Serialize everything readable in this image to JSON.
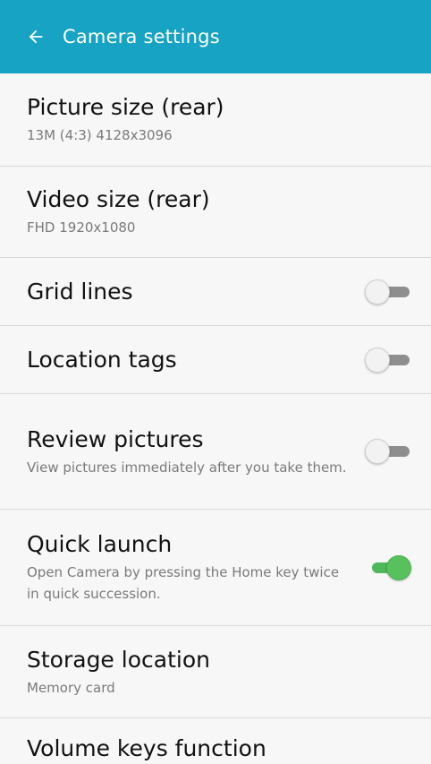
{
  "header": {
    "title": "Camera settings",
    "back_icon": "arrow-left-icon",
    "color": "#17a3c3"
  },
  "settings": [
    {
      "label": "Picture size (rear)",
      "sub": "13M (4:3) 4128x3096"
    },
    {
      "label": "Video size (rear)",
      "sub": "FHD 1920x1080"
    },
    {
      "label": "Grid lines",
      "toggle": false
    },
    {
      "label": "Location tags",
      "toggle": false
    },
    {
      "label": "Review pictures",
      "sub": "View pictures immediately after you take them.",
      "toggle": false
    },
    {
      "label": "Quick launch",
      "sub": "Open Camera by pressing the Home key twice in quick succession.",
      "toggle": true
    },
    {
      "label": "Storage location",
      "sub": "Memory card"
    },
    {
      "label": "Volume keys function"
    }
  ]
}
